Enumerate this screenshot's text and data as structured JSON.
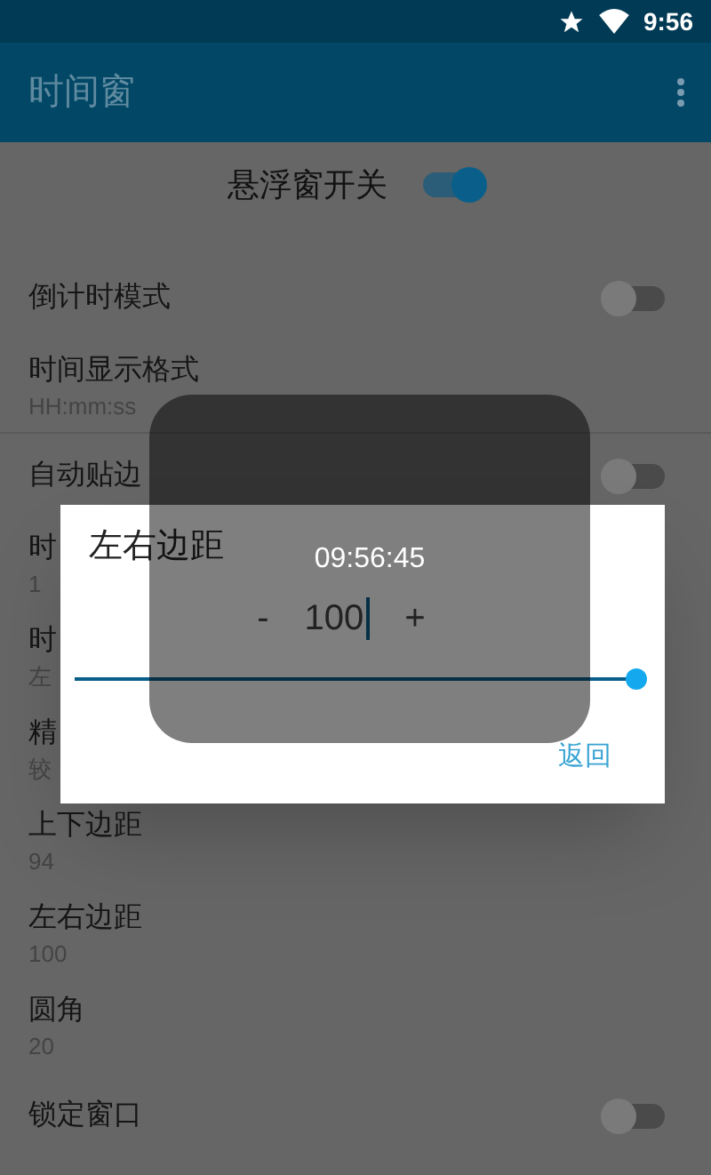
{
  "status_bar": {
    "time": "9:56"
  },
  "app_bar": {
    "title": "时间窗"
  },
  "master_switch": {
    "label": "悬浮窗开关",
    "on": true
  },
  "settings": [
    {
      "kind": "switch",
      "title": "倒计时模式",
      "on": false
    },
    {
      "kind": "value",
      "title": "时间显示格式",
      "value": "HH:mm:ss",
      "divider": true
    },
    {
      "kind": "switch",
      "title": "自动贴边",
      "on": false
    },
    {
      "kind": "value",
      "title": "时",
      "value": "1"
    },
    {
      "kind": "value",
      "title": "时",
      "value": "左"
    },
    {
      "kind": "value",
      "title": "精",
      "value": "较"
    },
    {
      "kind": "value",
      "title": "上下边距",
      "value": "94"
    },
    {
      "kind": "value",
      "title": "左右边距",
      "value": "100"
    },
    {
      "kind": "value",
      "title": "圆角",
      "value": "20"
    },
    {
      "kind": "switch",
      "title": "锁定窗口",
      "on": false
    }
  ],
  "dialog": {
    "title": "左右边距",
    "minus": "-",
    "value": "100",
    "plus": "+",
    "level": 1,
    "button": "返回"
  },
  "floating_window": {
    "time": "09:56:45"
  }
}
